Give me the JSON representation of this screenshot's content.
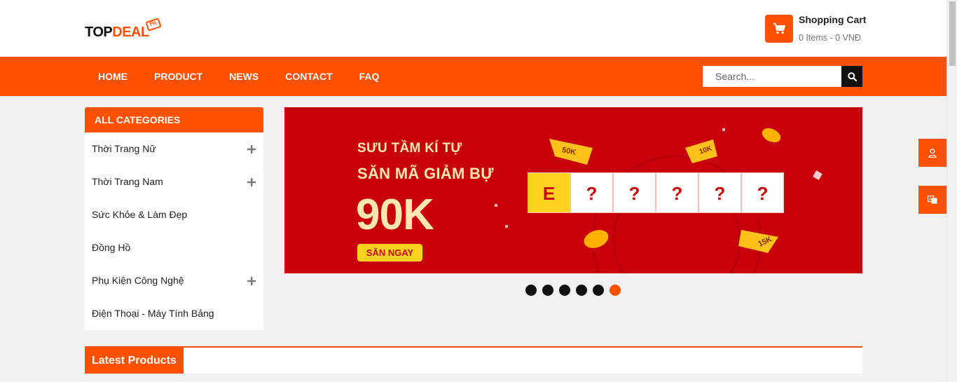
{
  "brand": {
    "logo_part1": "TOP",
    "logo_part2": "DEAL",
    "logo_badge": "f%",
    "accent_color": "#ff5100"
  },
  "cart": {
    "icon": "cart-icon",
    "title": "Shopping Cart",
    "summary": "0 Items - 0 VNĐ"
  },
  "nav": {
    "items": [
      "HOME",
      "PRODUCT",
      "NEWS",
      "CONTACT",
      "FAQ"
    ]
  },
  "search": {
    "placeholder": "Search...",
    "icon": "search-icon"
  },
  "categories": {
    "header": "ALL CATEGORIES",
    "items": [
      {
        "label": "Thời Trang Nữ",
        "expandable": true
      },
      {
        "label": "Thời Trang Nam",
        "expandable": true
      },
      {
        "label": "Sức Khỏe & Làm Đẹp",
        "expandable": false
      },
      {
        "label": "Đồng Hồ",
        "expandable": false
      },
      {
        "label": "Phụ Kiện Công Nghệ",
        "expandable": true
      },
      {
        "label": "Điện Thoại - Máy Tính Bảng",
        "expandable": false
      }
    ]
  },
  "banner": {
    "line1": "SƯU TẦM KÍ TỰ",
    "line2": "SĂN MÃ GIẢM BỰ",
    "amount": "90K",
    "cta": "SĂN NGAY",
    "puzzle": [
      "E",
      "?",
      "?",
      "?",
      "?",
      "?"
    ],
    "tags": [
      "50K",
      "10K",
      "15K"
    ],
    "background_color": "#c8000a"
  },
  "slider": {
    "dot_count": 6,
    "active_index": 5
  },
  "side_buttons": [
    "user-icon",
    "translate-icon"
  ],
  "latest": {
    "title": "Latest Products"
  }
}
